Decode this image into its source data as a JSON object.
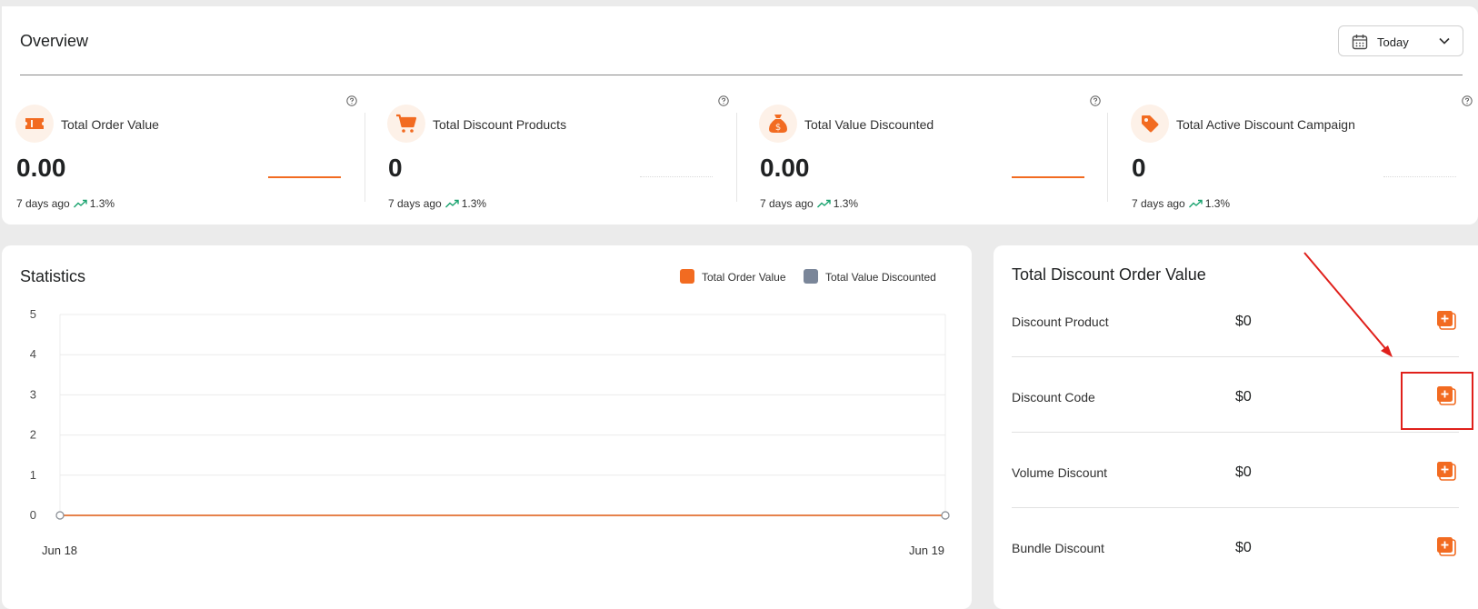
{
  "overview": {
    "title": "Overview",
    "date_range": {
      "selected": "Today",
      "icon": "calendar-icon"
    },
    "stats": [
      {
        "label": "Total Order Value",
        "value": "0.00",
        "period": "7 days ago",
        "change": "1.3%",
        "icon": "ticket-icon",
        "sparkline": "line"
      },
      {
        "label": "Total Discount Products",
        "value": "0",
        "period": "7 days ago",
        "change": "1.3%",
        "icon": "cart-icon",
        "sparkline": "dotted"
      },
      {
        "label": "Total Value Discounted",
        "value": "0.00",
        "period": "7 days ago",
        "change": "1.3%",
        "icon": "money-bag-icon",
        "sparkline": "line"
      },
      {
        "label": "Total Active Discount Campaign",
        "value": "0",
        "period": "7 days ago",
        "change": "1.3%",
        "icon": "tag-icon",
        "sparkline": "dotted"
      }
    ]
  },
  "statistics": {
    "title": "Statistics",
    "chart_data": {
      "type": "line",
      "x": [
        "Jun 18",
        "Jun 19"
      ],
      "series": [
        {
          "name": "Total Order Value",
          "values": [
            0,
            0
          ]
        },
        {
          "name": "Total Value Discounted",
          "values": [
            0,
            0
          ]
        }
      ],
      "yticks": [
        0,
        1,
        2,
        3,
        4,
        5
      ],
      "ylim": [
        0,
        5
      ],
      "grid": true,
      "legend": "top-right"
    }
  },
  "discount_totals": {
    "title": "Total Discount Order Value",
    "rows": [
      {
        "label": "Discount Product",
        "value": "$0",
        "icon": "add-copy-icon"
      },
      {
        "label": "Discount Code",
        "value": "$0",
        "icon": "add-copy-icon"
      },
      {
        "label": "Volume Discount",
        "value": "$0",
        "icon": "add-copy-icon"
      },
      {
        "label": "Bundle Discount",
        "value": "$0",
        "icon": "add-copy-icon"
      }
    ]
  },
  "colors": {
    "accent": "#f26b21",
    "secondary_series": "#7a8699",
    "trend_up": "#1aa36f",
    "annotation": "#e0201b"
  }
}
